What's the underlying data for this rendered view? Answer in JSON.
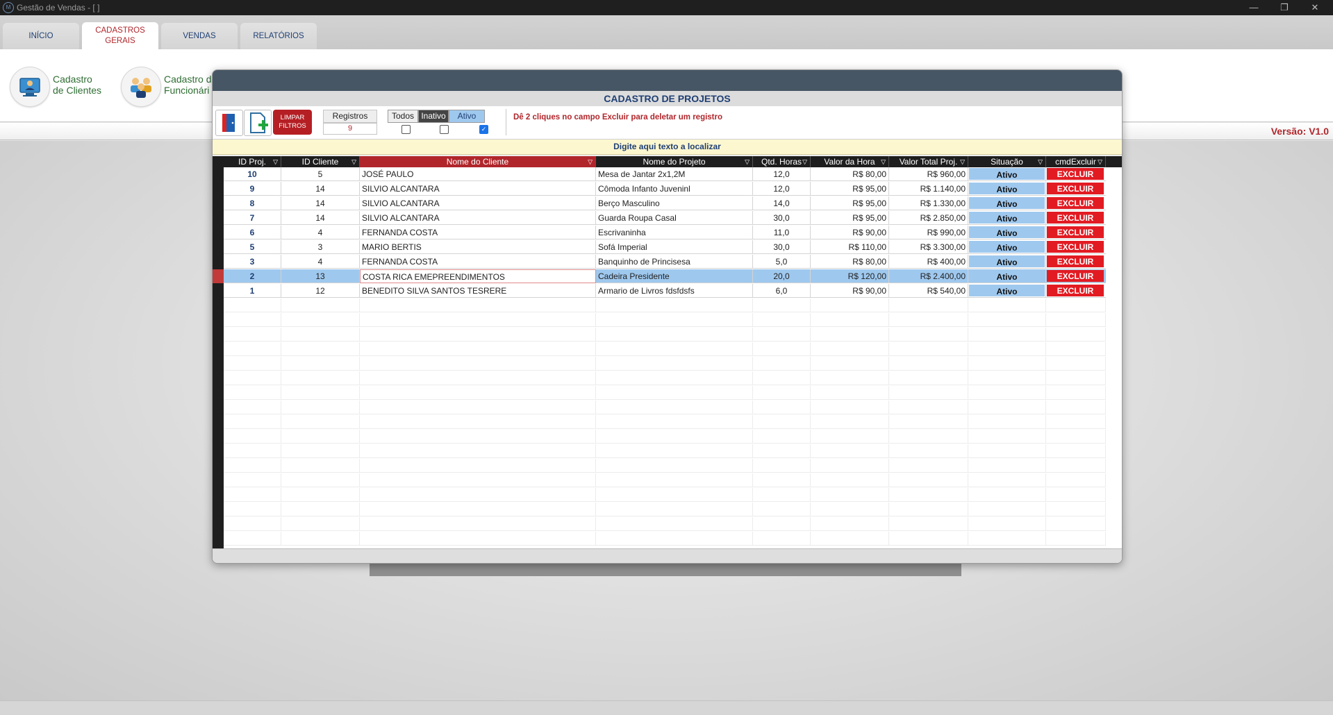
{
  "window": {
    "title": "Gestão de Vendas - [ ]",
    "icon": "app-logo-icon"
  },
  "tabs": [
    {
      "label": "INÍCIO",
      "active": false
    },
    {
      "label": "CADASTROS\nGERAIS",
      "active": true
    },
    {
      "label": "VENDAS",
      "active": false
    },
    {
      "label": "RELATÓRIOS",
      "active": false
    }
  ],
  "ribbon": {
    "items": [
      {
        "line1": "Cadastro",
        "line2": "de Clientes",
        "icon": "client-computer-icon"
      },
      {
        "line1": "Cadastro d",
        "line2": "Funcionári",
        "icon": "employees-group-icon"
      }
    ]
  },
  "status": {
    "version": "Versão: V1.0"
  },
  "modal": {
    "title": "CADASTRO DE PROJETOS",
    "toolbar": {
      "exit_icon": "exit-door-icon",
      "new_icon": "new-document-icon",
      "clear_filters": "LIMPAR\nFILTROS",
      "records_label": "Registros",
      "records_count": "9",
      "filters": [
        {
          "label": "Todos",
          "checked": false
        },
        {
          "label": "Inativo",
          "checked": false
        },
        {
          "label": "Ativo",
          "checked": true
        }
      ],
      "hint": "Dê 2 cliques no campo Excluir para deletar um registro"
    },
    "search_placeholder": "Digite aqui texto a localizar",
    "columns": [
      "ID Proj.",
      "ID Cliente",
      "Nome do Cliente",
      "Nome do Projeto",
      "Qtd. Horas",
      "Valor da Hora",
      "Valor Total Proj.",
      "Situação",
      "cmdExcluir"
    ],
    "rows": [
      {
        "id": "10",
        "client_id": "5",
        "client": "JOSÉ PAULO",
        "project": "Mesa de Jantar 2x1,2M",
        "hours": "12,0",
        "rate": "R$ 80,00",
        "total": "R$ 960,00",
        "status": "Ativo",
        "action": "EXCLUIR"
      },
      {
        "id": "9",
        "client_id": "14",
        "client": "SILVIO ALCANTARA",
        "project": "Cômoda Infanto Juveninl",
        "hours": "12,0",
        "rate": "R$ 95,00",
        "total": "R$ 1.140,00",
        "status": "Ativo",
        "action": "EXCLUIR"
      },
      {
        "id": "8",
        "client_id": "14",
        "client": "SILVIO ALCANTARA",
        "project": "Berço Masculino",
        "hours": "14,0",
        "rate": "R$ 95,00",
        "total": "R$ 1.330,00",
        "status": "Ativo",
        "action": "EXCLUIR"
      },
      {
        "id": "7",
        "client_id": "14",
        "client": "SILVIO ALCANTARA",
        "project": "Guarda Roupa Casal",
        "hours": "30,0",
        "rate": "R$ 95,00",
        "total": "R$ 2.850,00",
        "status": "Ativo",
        "action": "EXCLUIR"
      },
      {
        "id": "6",
        "client_id": "4",
        "client": "FERNANDA COSTA",
        "project": "Escrivaninha",
        "hours": "11,0",
        "rate": "R$ 90,00",
        "total": "R$ 990,00",
        "status": "Ativo",
        "action": "EXCLUIR"
      },
      {
        "id": "5",
        "client_id": "3",
        "client": "MARIO BERTIS",
        "project": "Sofá Imperial",
        "hours": "30,0",
        "rate": "R$ 110,00",
        "total": "R$ 3.300,00",
        "status": "Ativo",
        "action": "EXCLUIR"
      },
      {
        "id": "3",
        "client_id": "4",
        "client": "FERNANDA COSTA",
        "project": "Banquinho de Princisesa",
        "hours": "5,0",
        "rate": "R$ 80,00",
        "total": "R$ 400,00",
        "status": "Ativo",
        "action": "EXCLUIR"
      },
      {
        "id": "2",
        "client_id": "13",
        "client": "COSTA RICA EMEPREENDIMENTOS",
        "project": "Cadeira Presidente",
        "hours": "20,0",
        "rate": "R$ 120,00",
        "total": "R$ 2.400,00",
        "status": "Ativo",
        "action": "EXCLUIR",
        "selected": true
      },
      {
        "id": "1",
        "client_id": "12",
        "client": "BENEDITO SILVA SANTOS TESRERE",
        "project": "Armario de Livros fdsfdsfs",
        "hours": "6,0",
        "rate": "R$ 90,00",
        "total": "R$ 540,00",
        "status": "Ativo",
        "action": "EXCLUIR"
      }
    ]
  }
}
